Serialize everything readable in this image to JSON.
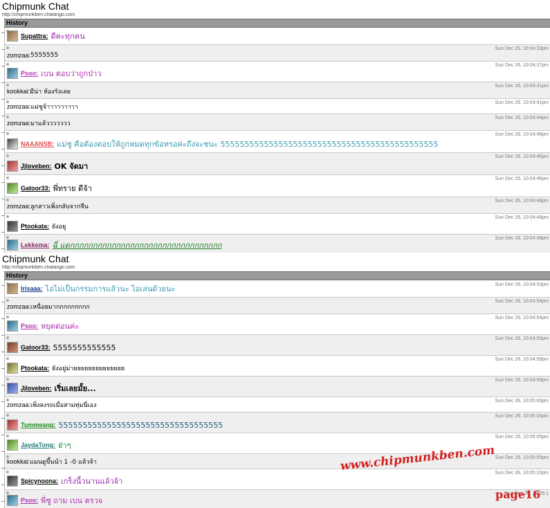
{
  "app": {
    "title": "Chipmunk Chat",
    "url": "http://chipmunkben.chatango.com",
    "history_label": "History"
  },
  "panel1": {
    "messages": [
      {
        "kind": "avatar",
        "name": "Supattra:",
        "name_color": "#000000",
        "text": "ดีคะทุกคน",
        "text_color": "#9b30b0",
        "text_size": 11,
        "ts": "",
        "h": 24
      },
      {
        "kind": "plain",
        "name": "zomzaa:",
        "text": "5555555",
        "text_color": "#000000",
        "text_size": 9,
        "ts": "Sun Dec 26, 10:04:33pm",
        "h": 24
      },
      {
        "kind": "avatar",
        "name": "Psoo:",
        "name_color": "#b030b0",
        "text": "เบน ตอบว่าถูกป่าว",
        "text_color": "#b030b0",
        "text_size": 11,
        "ts": "Sun Dec 26, 10:04:37pm",
        "h": 30
      },
      {
        "kind": "plain",
        "name": "kookkai:",
        "text": "มีน่า ห้องรังเลย",
        "text_color": "#000000",
        "text_size": 9,
        "ts": "Sun Dec 26, 10:04:41pm",
        "h": 24
      },
      {
        "kind": "plain",
        "name": "zomzaa:",
        "text": "แม่ชูจ้าาาาาาาาา",
        "text_color": "#000000",
        "text_size": 9,
        "ts": "Sun Dec 26, 10:04:41pm",
        "h": 22
      },
      {
        "kind": "plain",
        "name": "zomzaa:",
        "text": "มาแล้ววววววว",
        "text_color": "#000000",
        "text_size": 9,
        "ts": "Sun Dec 26, 10:04:44pm",
        "h": 24
      },
      {
        "kind": "avatar",
        "name": "NAAANSB:",
        "name_color": "#e05050",
        "text": "แม่ชู คือต้องตอบให้ถูกหมดทุกข้อหรอค่ะถึงจะชนะ 555555555555555555555555555555555555555555555",
        "text_color": "#3a9ab0",
        "text_size": 11,
        "ts": "Sun Dec 26, 10:04:46pm",
        "h": 32
      },
      {
        "kind": "avatar",
        "name": "Jjloveben:",
        "name_color": "#000000",
        "text": "OK จัดมา",
        "text_color": "#000000",
        "text_size": 11,
        "ts": "Sun Dec 26, 10:04:46pm",
        "bold": true,
        "h": 32
      },
      {
        "kind": "avatar",
        "name": "Gatoor33:",
        "name_color": "#000000",
        "text": "พี่ทราย ดีจ้า",
        "text_color": "#000000",
        "text_size": 11,
        "ts": "Sun Dec 26, 10:04:46pm",
        "h": 32
      },
      {
        "kind": "plain",
        "name": "zomzaa:",
        "text": "ลูกสาวเพิ่งกลับจากจีน",
        "text_color": "#000000",
        "text_size": 9,
        "ts": "Sun Dec 26, 10:04:48pm",
        "h": 24
      },
      {
        "kind": "avatar",
        "name": "Ptookata:",
        "name_color": "#000000",
        "text": "ยังอยู",
        "text_color": "#000000",
        "text_size": 9,
        "ts": "Sun Dec 26, 10:04:48pm",
        "h": 30
      },
      {
        "kind": "avatar",
        "name": "Lekkema:",
        "name_color": "#8a2a6a",
        "text": "ฉี่ แตกกกกกกกกกกกกกกกกกกกกกกกกกกกกกกกกก",
        "text_color": "#207a20",
        "text_size": 11,
        "ts": "Sun Dec 26, 10:04:49pm",
        "italic": true,
        "underline": true,
        "h": 28
      }
    ]
  },
  "panel2": {
    "messages": [
      {
        "kind": "avatar",
        "name": "Irisaaa:",
        "name_color": "#1a3a8a",
        "text": "ไอไม่เป็นกรรมการแล้วนะ ไอเล่นด้วยนะ",
        "text_color": "#3a9ab0",
        "text_size": 11,
        "ts": "Sun Dec 26, 10:04:53pm",
        "h": 24
      },
      {
        "kind": "plain",
        "name": "zomzaa:",
        "text": "เหนื่อยมากกกกกกกกก",
        "text_color": "#000000",
        "text_size": 9,
        "ts": "Sun Dec 26, 10:04:54pm",
        "h": 24
      },
      {
        "kind": "avatar",
        "name": "Psoo:",
        "name_color": "#b030b0",
        "text": "หยุดต่อนค่ะ",
        "text_color": "#b030b0",
        "text_size": 11,
        "ts": "Sun Dec 26, 10:04:54pm",
        "h": 30
      },
      {
        "kind": "avatar",
        "name": "Gatoor33:",
        "name_color": "#000000",
        "text": "5555555555555",
        "text_color": "#000000",
        "text_size": 11,
        "ts": "Sun Dec 26, 10:04:55pm",
        "h": 30
      },
      {
        "kind": "avatar",
        "name": "Ptookata:",
        "name_color": "#000000",
        "text": "ยังอยู่ม่ายยยยยยยยยยยยยย",
        "text_color": "#000000",
        "text_size": 9,
        "ts": "Sun Dec 26, 10:04:59pm",
        "h": 30
      },
      {
        "kind": "avatar",
        "name": "Jjloveben:",
        "name_color": "#000000",
        "text": "เริ่มเลยมั้ย...",
        "text_color": "#000000",
        "text_size": 11,
        "ts": "Sun Dec 26, 10:04:59pm",
        "bold": true,
        "h": 30
      },
      {
        "kind": "plain",
        "name": "zomzaa:",
        "text": "เพิ่งลงรถเมื่อสามทุ่มนี่เอง",
        "text_color": "#000000",
        "text_size": 9,
        "ts": "Sun Dec 26, 10:05:00pm",
        "h": 22
      },
      {
        "kind": "avatar",
        "name": "Tummeang:",
        "name_color": "#208a20",
        "text": "5555555555555555555555555555555555",
        "text_color": "#1a5a7a",
        "text_size": 11,
        "ts": "Sun Dec 26, 10:05:04pm",
        "h": 30
      },
      {
        "kind": "avatar",
        "name": "JaydaTong:",
        "name_color": "#207a7a",
        "text": "ฮ่าๆ",
        "text_color": "#208a40",
        "text_size": 11,
        "ts": "Sun Dec 26, 10:05:05pm",
        "h": 30
      },
      {
        "kind": "plain",
        "name": "kookkai:",
        "text": "แมนยูขึ้นนำ 1 -0 แล้วจ้า",
        "text_color": "#000000",
        "text_size": 9,
        "ts": "Sun Dec 26, 10:05:05pm",
        "h": 22
      },
      {
        "kind": "avatar",
        "name": "Spicynoona:",
        "name_color": "#000000",
        "text": "เกร็งนี้วนานแล้วจ้า",
        "text_color": "#9b30b0",
        "text_size": 11,
        "ts": "Sun Dec 26, 10:05:10pm",
        "h": 30
      },
      {
        "kind": "avatar",
        "name": "Psoo:",
        "name_color": "#b030b0",
        "text": "พี่ชู ถาม เบน ตรวจ",
        "text_color": "#b030b0",
        "text_size": 11,
        "ts": "Sun Dec 26, 10:05:1",
        "h": 28
      }
    ]
  },
  "watermark": "www.chipmunkben.com",
  "page_label": "page16"
}
